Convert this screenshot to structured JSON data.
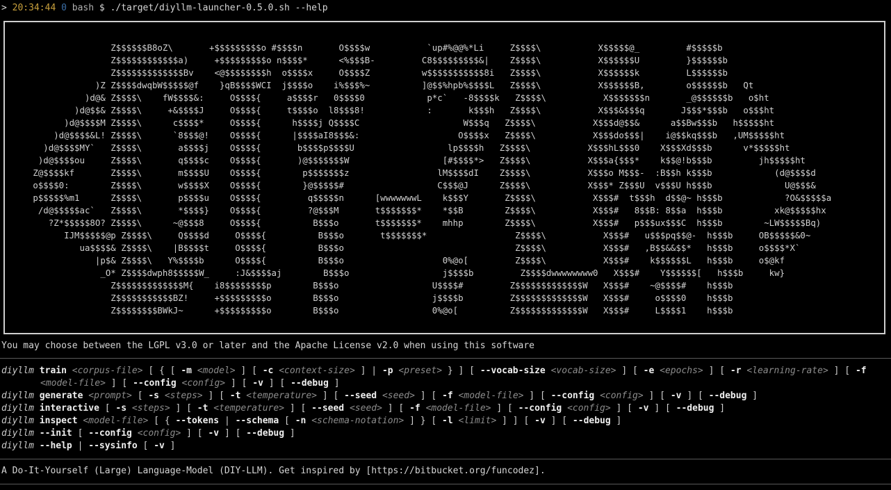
{
  "terminal": {
    "prompt": {
      "marker": ">",
      "time": "20:34:44",
      "exit_code": "0",
      "shell": "bash",
      "symbol": "$",
      "command": "./target/diyllm-launcher-0.5.0.sh --help"
    },
    "banner_art": [
      "                  Z$$$$$$B8oZ\\       +$$$$$$$$$o #$$$$n       O$$$$w           `up#%@@%*Li     Z$$$$\\           X$$$$$@_         #$$$$$b",
      "                  Z$$$$$$$$$$$$a)     +$$$$$$$$$o n$$$$*      <%$$$B-         C8$$$$$$$$$&|    Z$$$$\\           X$$$$$$U         }$$$$$$b",
      "                  Z$$$$$$$$$$$$$Bv    <@$$$$$$$$h  o$$$$x     O$$$$Z          w$$$$$$$$$$$8i   Z$$$$\\           X$$$$$$k         L$$$$$$b",
      "               )Z Z$$$$dwqbW$$$$$@f    }qB$$$$WCI  j$$$$o    i%$$$%~          ]@$$%hpb%$$$$L   Z$$$$\\           X$$$$$$B,        o$$$$$$b   Qt",
      "             )d@& Z$$$$\\    fW$$$$&:     O$$$${     a$$$$r   0$$$$0            p*c`   -8$$$$k   Z$$$$\\           X$$$$$$$n       _@$$$$$$b   o$ht",
      "           )d@$$& Z$$$$\\     +&$$$$J     O$$$${     t$$$$o  l8$$$8!            :       k$$$h   Z$$$$\\           X$$$&$$$q       J$$$*$$$b   o$$$ht",
      "         )d@$$$$M Z$$$$\\      c$$$$*     O$$$${      h$$$$j Q$$$$C                    W$$$q   Z$$$$\\           X$$$d@$$&      a$$Bw$$$b   h$$$$$ht",
      "       )d@$$$$&L! Z$$$$\\      `8$$$@!    O$$$${      |$$$$aI8$$$&:                   O$$$$x   Z$$$$\\           X$$$do$$$|    i@$$kq$$$b   ,UM$$$$$ht",
      "     )d@$$$$MY`   Z$$$$\\       a$$$$j    O$$$${       b$$$$p$$$$U                  lp$$$$h   Z$$$$\\           X$$$hL$$$0    X$$$Xd$$$b      v*$$$$$ht",
      "    )d@$$$$ou     Z$$$$\\       q$$$$c    O$$$${       )@$$$$$$$W                  [#$$$$*>   Z$$$$\\           X$$$a{$$$*    k$$@!b$$$b         jh$$$$$ht",
      "   Z@$$$$kf       Z$$$$\\       m$$$$U    O$$$${        p$$$$$$$z                 lM$$$$dI    Z$$$$\\           X$$$o M$$$-  :B$$h k$$$b            (d@$$$$d",
      "   o$$$$0:        Z$$$$\\       w$$$$X    O$$$${        }@$$$$$#                  C$$$@J      Z$$$$\\           X$$$* Z$$$U  v$$$U h$$$b              U@$$$&",
      "   p$$$$$%m1      Z$$$$\\       p$$$$u    O$$$${         q$$$$$n      [wwwwwwwL    k$$$Y       Z$$$$\\           X$$$#  t$$$h  d$$@~ h$$$b            ?O&$$$$$a",
      "    /d@$$$$$ac`   Z$$$$\\       *$$$$}    O$$$${         ?@$$$M       t$$$$$$$*    *$$B        Z$$$$\\           X$$$#   8$$B: 8$$a  h$$$b          xk@$$$$$hx",
      "      ?Z*$$$$$8O? Z$$$$\\      ~@$$$8     O$$$${          B$$$o       t$$$$$$$*    mhhp        Z$$$$\\           X$$$#   p$$$ux$$$C  h$$$b        ~LW$$$$$Bq)",
      "         IJM$$$$$@p Z$$$$\\     Q$$$$d     O$$$${          B$$$o       t$$$$$$$*                 Z$$$$\\           X$$$#   u$$$pq$$@-  h$$$b     OB$$$$$&0~",
      "            ua$$$$& Z$$$$\\    |B$$$$t     O$$$${          B$$$o                                 Z$$$$\\           X$$$#   ,B$$&&$$*   h$$$b     o$$$$*X`",
      "               |p$& Z$$$$\\   Y%$$$$b      O$$$${          B$$$o                   0%@o[         Z$$$$\\           X$$$#    k$$$$$$L   h$$$b     o$@kf",
      "                _O* Z$$$$dwph8$$$$$W_     :J&$$$$aj        B$$$o                  j$$$$b         Z$$$$dwwwwwwww0   X$$$#    Y$$$$$$[   h$$$b     kw}",
      "                  Z$$$$$$$$$$$$$M{    i8$$$$$$$$p        B$$$o                  U$$$$#         Z$$$$$$$$$$$$$W   X$$$#    ~@$$$$#    h$$$b",
      "                  Z$$$$$$$$$$$BZ!     +$$$$$$$$$o        B$$$o                  j$$$$b         Z$$$$$$$$$$$$$W   X$$$#     o$$$$0    h$$$b",
      "                  Z$$$$$$$$BWkJ~      +$$$$$$$$$o        B$$$o                  0%@o[          Z$$$$$$$$$$$$$W   X$$$#     L$$$$1    h$$$b"
    ],
    "license": "You may choose between the LGPL v3.0 or later and the Apache License v2.0 when using this software",
    "usage": {
      "program": "diyllm",
      "lines": [
        {
          "wrap": true,
          "tokens": [
            {
              "t": "cmd",
              "v": "train"
            },
            {
              "t": "arg",
              "v": "<corpus-file>"
            },
            {
              "t": "punct",
              "v": "[ { [ "
            },
            {
              "t": "flag",
              "v": "-m"
            },
            {
              "t": "arg",
              "v": "<model>"
            },
            {
              "t": "punct",
              "v": "] [ "
            },
            {
              "t": "flag",
              "v": "-c"
            },
            {
              "t": "arg",
              "v": "<context-size>"
            },
            {
              "t": "punct",
              "v": "] | "
            },
            {
              "t": "flag",
              "v": "-p"
            },
            {
              "t": "arg",
              "v": "<preset>"
            },
            {
              "t": "punct",
              "v": "} ] [ "
            },
            {
              "t": "flag",
              "v": "--vocab-size"
            },
            {
              "t": "arg",
              "v": "<vocab-size>"
            },
            {
              "t": "punct",
              "v": "] [ "
            },
            {
              "t": "flag",
              "v": "-e"
            },
            {
              "t": "arg",
              "v": "<epochs>"
            },
            {
              "t": "punct",
              "v": "] [ "
            },
            {
              "t": "flag",
              "v": "-r"
            },
            {
              "t": "arg",
              "v": "<learning-rate>"
            },
            {
              "t": "punct",
              "v": "] [ "
            },
            {
              "t": "flag",
              "v": "-f"
            },
            {
              "t": "arg",
              "v": "<model-file>"
            },
            {
              "t": "punct",
              "v": "] [ "
            },
            {
              "t": "flag",
              "v": "--config"
            },
            {
              "t": "arg",
              "v": "<config>"
            },
            {
              "t": "punct",
              "v": "] [ "
            },
            {
              "t": "flag",
              "v": "-v"
            },
            {
              "t": "punct",
              "v": "] [ "
            },
            {
              "t": "flag",
              "v": "--debug"
            },
            {
              "t": "punct",
              "v": "]"
            }
          ]
        },
        {
          "wrap": false,
          "tokens": [
            {
              "t": "cmd",
              "v": "generate"
            },
            {
              "t": "arg",
              "v": "<prompt>"
            },
            {
              "t": "punct",
              "v": "[ "
            },
            {
              "t": "flag",
              "v": "-s"
            },
            {
              "t": "arg",
              "v": "<steps>"
            },
            {
              "t": "punct",
              "v": "] [ "
            },
            {
              "t": "flag",
              "v": "-t"
            },
            {
              "t": "arg",
              "v": "<temperature>"
            },
            {
              "t": "punct",
              "v": "] [ "
            },
            {
              "t": "flag",
              "v": "--seed"
            },
            {
              "t": "arg",
              "v": "<seed>"
            },
            {
              "t": "punct",
              "v": "] [ "
            },
            {
              "t": "flag",
              "v": "-f"
            },
            {
              "t": "arg",
              "v": "<model-file>"
            },
            {
              "t": "punct",
              "v": "] [ "
            },
            {
              "t": "flag",
              "v": "--config"
            },
            {
              "t": "arg",
              "v": "<config>"
            },
            {
              "t": "punct",
              "v": "] [ "
            },
            {
              "t": "flag",
              "v": "-v"
            },
            {
              "t": "punct",
              "v": "] [ "
            },
            {
              "t": "flag",
              "v": "--debug"
            },
            {
              "t": "punct",
              "v": "]"
            }
          ]
        },
        {
          "wrap": false,
          "tokens": [
            {
              "t": "cmd",
              "v": "interactive"
            },
            {
              "t": "punct",
              "v": "[ "
            },
            {
              "t": "flag",
              "v": "-s"
            },
            {
              "t": "arg",
              "v": "<steps>"
            },
            {
              "t": "punct",
              "v": "] [ "
            },
            {
              "t": "flag",
              "v": "-t"
            },
            {
              "t": "arg",
              "v": "<temperature>"
            },
            {
              "t": "punct",
              "v": "] [ "
            },
            {
              "t": "flag",
              "v": "--seed"
            },
            {
              "t": "arg",
              "v": "<seed>"
            },
            {
              "t": "punct",
              "v": "] [ "
            },
            {
              "t": "flag",
              "v": "-f"
            },
            {
              "t": "arg",
              "v": "<model-file>"
            },
            {
              "t": "punct",
              "v": "] [ "
            },
            {
              "t": "flag",
              "v": "--config"
            },
            {
              "t": "arg",
              "v": "<config>"
            },
            {
              "t": "punct",
              "v": "] [ "
            },
            {
              "t": "flag",
              "v": "-v"
            },
            {
              "t": "punct",
              "v": "] [ "
            },
            {
              "t": "flag",
              "v": "--debug"
            },
            {
              "t": "punct",
              "v": "]"
            }
          ]
        },
        {
          "wrap": false,
          "tokens": [
            {
              "t": "cmd",
              "v": "inspect"
            },
            {
              "t": "arg",
              "v": "<model-file>"
            },
            {
              "t": "punct",
              "v": "[ { "
            },
            {
              "t": "flag",
              "v": "--tokens"
            },
            {
              "t": "punct",
              "v": "| "
            },
            {
              "t": "flag",
              "v": "--schema"
            },
            {
              "t": "punct",
              "v": "[ "
            },
            {
              "t": "flag",
              "v": "-n"
            },
            {
              "t": "arg",
              "v": "<schema-notation>"
            },
            {
              "t": "punct",
              "v": "] } [ "
            },
            {
              "t": "flag",
              "v": "-l"
            },
            {
              "t": "arg",
              "v": "<limit>"
            },
            {
              "t": "punct",
              "v": "] ] [ "
            },
            {
              "t": "flag",
              "v": "-v"
            },
            {
              "t": "punct",
              "v": "] [ "
            },
            {
              "t": "flag",
              "v": "--debug"
            },
            {
              "t": "punct",
              "v": "]"
            }
          ]
        },
        {
          "wrap": false,
          "tokens": [
            {
              "t": "flag",
              "v": "--init"
            },
            {
              "t": "punct",
              "v": "[ "
            },
            {
              "t": "flag",
              "v": "--config"
            },
            {
              "t": "arg",
              "v": "<config>"
            },
            {
              "t": "punct",
              "v": "] [ "
            },
            {
              "t": "flag",
              "v": "-v"
            },
            {
              "t": "punct",
              "v": "] [ "
            },
            {
              "t": "flag",
              "v": "--debug"
            },
            {
              "t": "punct",
              "v": "]"
            }
          ]
        },
        {
          "wrap": false,
          "tokens": [
            {
              "t": "flag",
              "v": "--help"
            },
            {
              "t": "punct",
              "v": "| "
            },
            {
              "t": "flag",
              "v": "--sysinfo"
            },
            {
              "t": "punct",
              "v": "[ "
            },
            {
              "t": "flag",
              "v": "-v"
            },
            {
              "t": "punct",
              "v": "]"
            }
          ]
        }
      ]
    },
    "footer": "A Do-It-Yourself (Large) Language-Model (DIY-LLM). Get inspired by [https://bitbucket.org/funcodez]."
  }
}
